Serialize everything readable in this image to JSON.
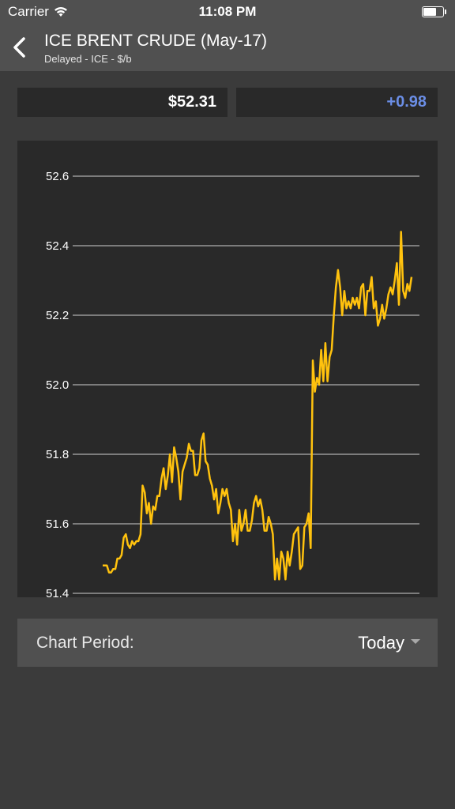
{
  "status_bar": {
    "carrier": "Carrier",
    "time": "11:08 PM"
  },
  "header": {
    "title": "ICE BRENT CRUDE (May-17)",
    "subtitle": "Delayed - ICE - $/b"
  },
  "quote": {
    "price": "$52.31",
    "change": "+0.98"
  },
  "colors": {
    "line": "#ffc20e",
    "positive": "#6b8ee6"
  },
  "chart_data": {
    "type": "line",
    "title": "",
    "xlabel": "",
    "ylabel": "",
    "ylim": [
      51.4,
      52.6
    ],
    "yticks": [
      "52.6",
      "52.4",
      "52.2",
      "52.0",
      "51.8",
      "51.6",
      "51.4"
    ],
    "grid": true,
    "series": [
      {
        "values": [
          51.48,
          51.48,
          51.48,
          51.46,
          51.46,
          51.47,
          51.47,
          51.5,
          51.5,
          51.51,
          51.56,
          51.57,
          51.54,
          51.53,
          51.55,
          51.54,
          51.55,
          51.55,
          51.57,
          51.71,
          51.69,
          51.63,
          51.66,
          51.6,
          51.65,
          51.64,
          51.68,
          51.68,
          51.73,
          51.76,
          51.7,
          51.74,
          51.8,
          51.72,
          51.82,
          51.79,
          51.75,
          51.67,
          51.75,
          51.77,
          51.79,
          51.83,
          51.81,
          51.81,
          51.74,
          51.74,
          51.76,
          51.84,
          51.86,
          51.78,
          51.77,
          51.73,
          51.71,
          51.67,
          51.7,
          51.63,
          51.66,
          51.7,
          51.68,
          51.7,
          51.66,
          51.64,
          51.55,
          51.6,
          51.54,
          51.64,
          51.58,
          51.6,
          51.64,
          51.58,
          51.58,
          51.61,
          51.66,
          51.68,
          51.65,
          51.67,
          51.64,
          51.58,
          51.58,
          51.62,
          51.6,
          51.57,
          51.44,
          51.5,
          51.44,
          51.52,
          51.5,
          51.44,
          51.52,
          51.48,
          51.52,
          51.57,
          51.58,
          51.59,
          51.47,
          51.48,
          51.59,
          51.6,
          51.63,
          51.53,
          52.07,
          51.98,
          52.02,
          52.0,
          52.1,
          52.01,
          52.12,
          52.01,
          52.08,
          52.1,
          52.2,
          52.28,
          52.33,
          52.28,
          52.2,
          52.27,
          52.22,
          52.24,
          52.22,
          52.25,
          52.23,
          52.25,
          52.22,
          52.28,
          52.29,
          52.2,
          52.27,
          52.27,
          52.31,
          52.22,
          52.24,
          52.17,
          52.19,
          52.23,
          52.19,
          52.22,
          52.26,
          52.28,
          52.26,
          52.3,
          52.35,
          52.23,
          52.44,
          52.27,
          52.25,
          52.29,
          52.27,
          52.31
        ]
      }
    ]
  },
  "period": {
    "label": "Chart Period:",
    "value": "Today"
  }
}
